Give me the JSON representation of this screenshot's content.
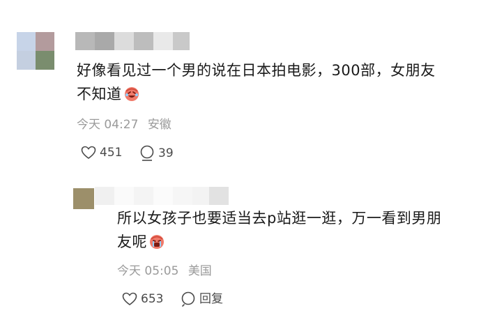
{
  "comments": [
    {
      "text_line1": "好像看见过一个男的说在日本拍电影，300部，女朋友",
      "text_line2": "不知道",
      "emoji_icon": "laughing-crying-emoji",
      "time": "今天 04:27",
      "location": "安徽",
      "likes": "451",
      "replies": "39"
    },
    {
      "text_line1": "所以女孩子也要适当去p站逛一逛，万一看到男朋",
      "text_line2": "友呢",
      "emoji_icon": "crying-emoji",
      "time": "今天 05:05",
      "location": "美国",
      "likes": "653",
      "reply_label": "回复"
    }
  ]
}
